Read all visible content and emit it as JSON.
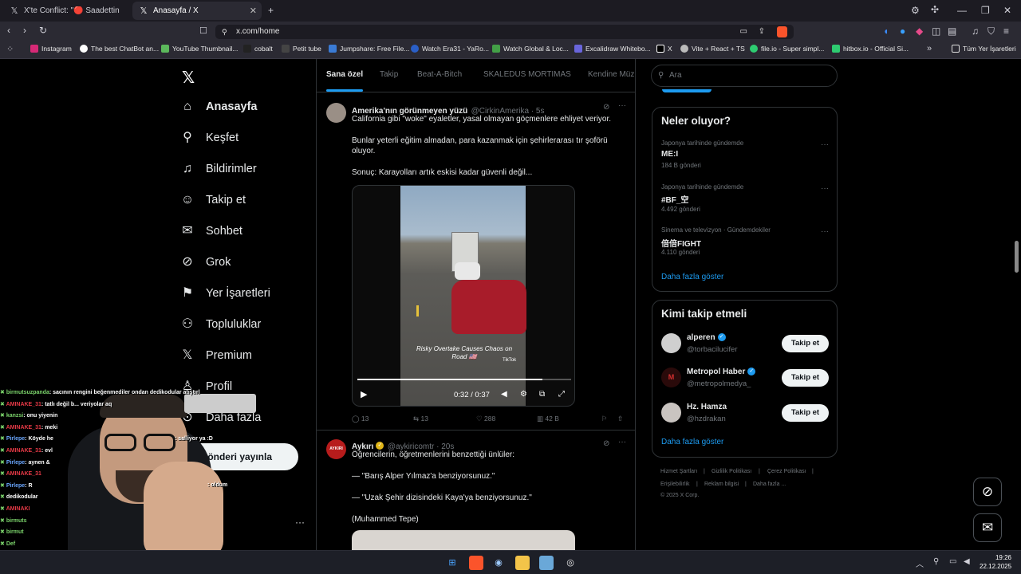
{
  "browser": {
    "tabs": [
      {
        "title": "X'te Conflict: \"🔴 Saadettin Saran ve"
      },
      {
        "title": "Anasayfa / X"
      }
    ],
    "url": "x.com/home",
    "bookmarks": [
      "Instagram",
      "The best ChatBot an...",
      "YouTube Thumbnail...",
      "cobalt",
      "Petit tube",
      "Jumpshare: Free File...",
      "Watch Era31 - YaRo...",
      "Watch Global & Loc...",
      "Excalidraw Whitebo...",
      "X",
      "Vite + React + TS",
      "file.io - Super simpl...",
      "hitbox.io - Official Si..."
    ],
    "all_bookmarks": "Tüm Yer İşaretleri"
  },
  "nav": {
    "items": [
      "Anasayfa",
      "Keşfet",
      "Bildirimler",
      "Takip et",
      "Sohbet",
      "Grok",
      "Yer İşaretleri",
      "Topluluklar",
      "Premium",
      "Profil",
      "Daha fazla"
    ],
    "post_button": "Gönderi yayınla"
  },
  "feed": {
    "tabs": [
      "Sana özel",
      "Takip",
      "Beat-A-Bitch",
      "SKALEDUS MORTIMAS",
      "Kendine Müz"
    ],
    "tweet1": {
      "name": "Amerika'nın görünmeyen yüzü",
      "handle": "@CirkinAmerika · 5s",
      "p1": "California gibi \"woke\" eyaletler, yasal olmayan göçmenlere ehliyet veriyor.",
      "p2": "Bunlar yeterli eğitim almadan, para kazanmak için şehirlerarası tır şoförü oluyor.",
      "p3": "Sonuç: Karayolları artık eskisi kadar güvenli değil...",
      "video_caption": "Risky Overtake Causes Chaos on Road 🇺🇸",
      "video_brand": "TikTok",
      "video_time": "0:32 / 0:37",
      "video_progress": 0.865,
      "replies": "13",
      "reposts": "13",
      "likes": "288",
      "views": "42 B"
    },
    "tweet2": {
      "name": "Aykırı",
      "handle": "@aykiricomtr · 20s",
      "avatar_text": "AYKIRI",
      "p1": "Öğrencilerin, öğretmenlerini benzettiği ünlüler:",
      "p2": "— \"Barış Alper Yılmaz'a benziyorsunuz.\"",
      "p3": "— \"Uzak Şehir dizisindeki Kaya'ya benziyorsunuz.\"",
      "p4": "(Muhammed Tepe)"
    }
  },
  "sidebar": {
    "search_placeholder": "Ara",
    "trends_title": "Neler oluyor?",
    "trends": [
      {
        "category": "Japonya tarihinde gündemde",
        "name": "ME:I",
        "count": "184 B gönderi"
      },
      {
        "category": "Japonya tarihinde gündemde",
        "name": "#BF_空",
        "count": "4.492 gönderi"
      },
      {
        "category": "Sinema ve televizyon · Gündemdekiler",
        "name": "倍倍FIGHT",
        "count": "4.110 gönderi"
      }
    ],
    "show_more": "Daha fazla göster",
    "follow_title": "Kimi takip etmeli",
    "who_to_follow": [
      {
        "name": "alperen",
        "handle": "@torbacilucifer",
        "button": "Takip et"
      },
      {
        "name": "Metropol Haber",
        "handle": "@metropolmedya_",
        "button": "Takip et"
      },
      {
        "name": "Hz. Hamza",
        "handle": "@hzdrakan",
        "button": "Takip et"
      }
    ],
    "footer": [
      "Hizmet Şartları",
      "|",
      "Gizlilik Politikası",
      "|",
      "Çerez Politikası",
      "|",
      "Erişilebilirlik",
      "|",
      "Reklam bilgisi",
      "|",
      "Daha fazla ...",
      "© 2025 X Corp."
    ]
  },
  "chat": [
    {
      "user": "birmutsuzpanda",
      "msg": ": sacının rengini beğenmediler ondan dedikodular atıştırl"
    },
    {
      "user": "AMINAKE_31",
      "msg": ": tatlı değil b... veriyolar aq"
    },
    {
      "user": "kanzsi",
      "msg": ": onu yiyenin"
    },
    {
      "user": "AMINAKE_31",
      "msg": ": meki"
    },
    {
      "user": "Pirlepe",
      "msg": ": Köyde he"
    },
    {
      "user": "AMINAKE_31",
      "msg": ": evl"
    },
    {
      "user": "Pirlepe",
      "msg": ": aynen &"
    },
    {
      "user": "AMINAKE_31",
      "msg": ""
    },
    {
      "user": "Pirlepe",
      "msg": ": R"
    },
    {
      "user": "dedikodular",
      "msg": ""
    },
    {
      "user": "AMINAKI",
      "msg": ""
    },
    {
      "user": "birmuts",
      "msg": ""
    },
    {
      "user": "birmut",
      "msg": ""
    },
    {
      "user": "Def",
      "msg": ""
    },
    {
      "user": "AMINA",
      "msg": ""
    },
    {
      "user": "birmu",
      "msg": ""
    }
  ],
  "chat_extra": [
    ": salliyor ya :D",
    ": oldum"
  ],
  "taskbar": {
    "time": "19:26",
    "date": "22.12.2025"
  },
  "colors": {
    "accent": "#1d9bf0",
    "background": "#000000",
    "border": "#2f3336",
    "browser_chrome": "#2b2a33"
  }
}
